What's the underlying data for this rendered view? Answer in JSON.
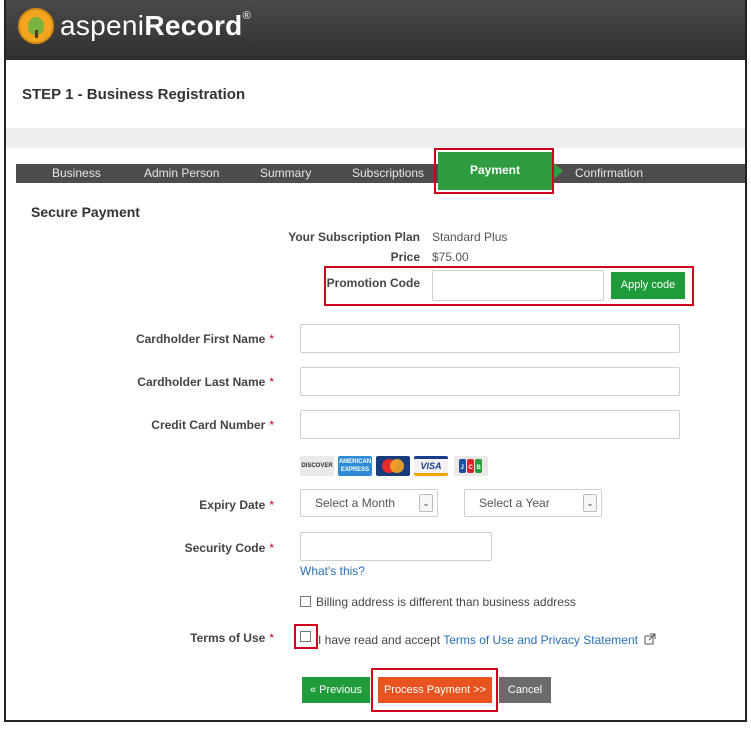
{
  "app": {
    "logo_text_light": "aspeni",
    "logo_text_bold": "Record",
    "logo_reg": "®",
    "logo_icon": "aspen-leaf-icon"
  },
  "step_title": "STEP 1 - Business Registration",
  "tabs": [
    {
      "label": "Business"
    },
    {
      "label": "Admin Person"
    },
    {
      "label": "Summary"
    },
    {
      "label": "Subscriptions"
    },
    {
      "label": "Payment",
      "active": true
    },
    {
      "label": "Confirmation"
    }
  ],
  "section_title": "Secure Payment",
  "plan": {
    "label": "Your Subscription Plan",
    "value": "Standard Plus",
    "price_label": "Price",
    "price_value": "$75.00"
  },
  "promo": {
    "label": "Promotion Code",
    "value": "",
    "button": "Apply code"
  },
  "fields": {
    "first_name": {
      "label": "Cardholder First Name",
      "value": ""
    },
    "last_name": {
      "label": "Cardholder Last Name",
      "value": ""
    },
    "card_number": {
      "label": "Credit Card Number",
      "value": ""
    },
    "expiry": {
      "label": "Expiry Date",
      "month": "Select a Month",
      "year": "Select a Year"
    },
    "security": {
      "label": "Security Code",
      "value": "",
      "help_link": "What's this?"
    },
    "required_mark": "*"
  },
  "cards": [
    {
      "label": "DISCOVER",
      "icon": "discover-card-icon",
      "color": "#e9e9e9"
    },
    {
      "label": "AMERICAN EXPRESS",
      "icon": "amex-card-icon",
      "color": "#2e8bd6"
    },
    {
      "label": "MasterCard",
      "icon": "mastercard-icon",
      "color": "#1a3c7a"
    },
    {
      "label": "VISA",
      "icon": "visa-card-icon",
      "color": "#f2f2f2"
    },
    {
      "label": "JCB",
      "icon": "jcb-card-icon",
      "color": "#e9e9e9"
    }
  ],
  "billing_checkbox": "Billing address is different than business address",
  "terms": {
    "label": "Terms of Use",
    "text_before": "I have read and accept ",
    "link": "Terms of Use and Privacy Statement",
    "external_icon": "external-link-icon"
  },
  "buttons": {
    "previous": "« Previous",
    "process": "Process Payment >>",
    "cancel": "Cancel"
  },
  "colors": {
    "accent_green": "#2d9d3f",
    "process_orange": "#e8531f",
    "highlight_red": "#d0021b",
    "link_blue": "#2a6fb8"
  }
}
